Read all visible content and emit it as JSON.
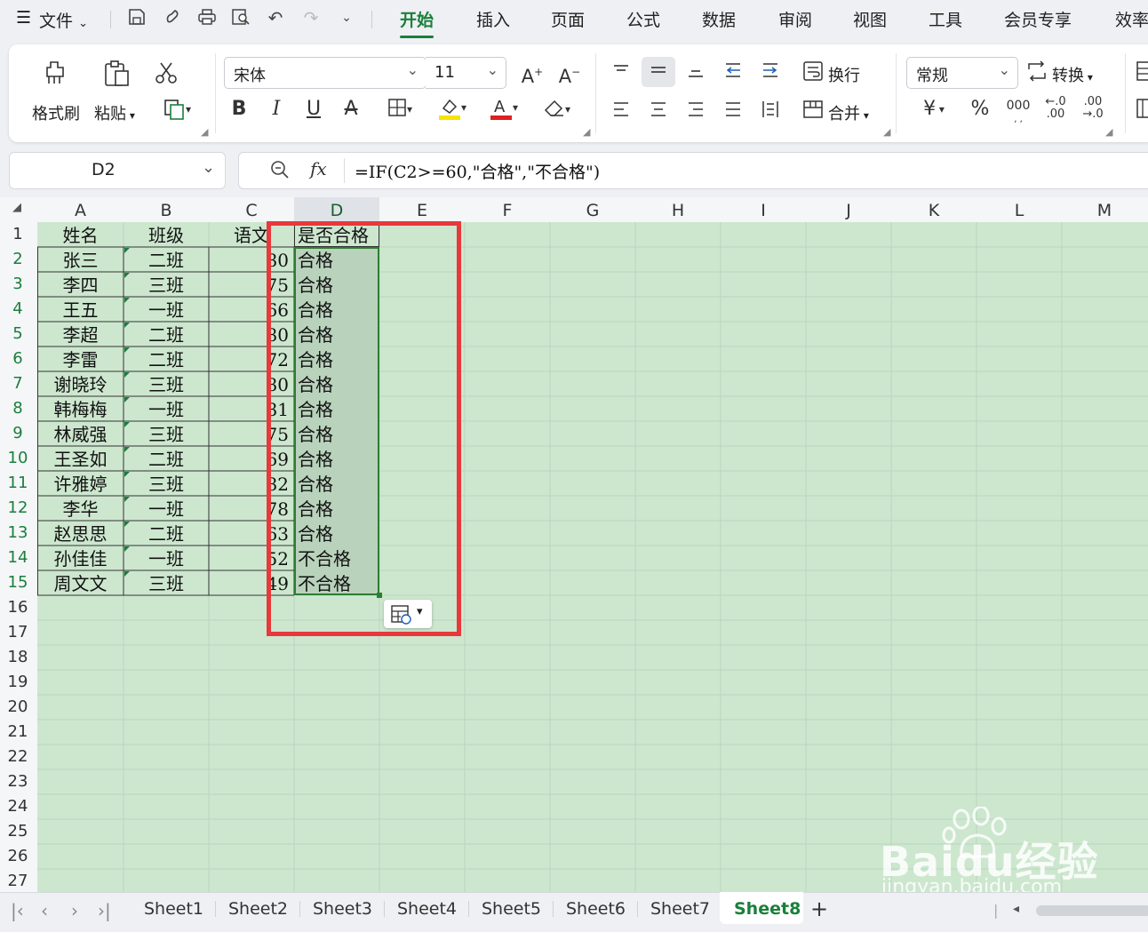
{
  "menu": {
    "file_label": "文件",
    "tabs": [
      "开始",
      "插入",
      "页面",
      "公式",
      "数据",
      "审阅",
      "视图",
      "工具",
      "会员专享",
      "效率"
    ],
    "active_tab_index": 0
  },
  "ribbon": {
    "format_painter": "格式刷",
    "paste": "粘贴",
    "font_name": "宋体",
    "font_size": "11",
    "wrap": "换行",
    "merge": "合并",
    "number_format": "常规",
    "convert": "转换",
    "currency_symbol": "¥",
    "percent_symbol": "%",
    "thousands_symbol": "000"
  },
  "formula_bar": {
    "cell_ref": "D2",
    "fx_label": "fx",
    "formula": "=IF(C2>=60,\"合格\",\"不合格\")"
  },
  "columns": [
    "A",
    "B",
    "C",
    "D",
    "E",
    "F",
    "G",
    "H",
    "I",
    "J",
    "K",
    "L",
    "M"
  ],
  "selected_column": "D",
  "rows": [
    "1",
    "2",
    "3",
    "4",
    "5",
    "6",
    "7",
    "8",
    "9",
    "10",
    "11",
    "12",
    "13",
    "14",
    "15",
    "16",
    "17",
    "18",
    "19",
    "20",
    "21",
    "22",
    "23",
    "24",
    "25",
    "26",
    "27"
  ],
  "header_row": [
    "姓名",
    "班级",
    "语文",
    "是否合格"
  ],
  "data_rows": [
    [
      "张三",
      "二班",
      "80",
      "合格"
    ],
    [
      "李四",
      "三班",
      "75",
      "合格"
    ],
    [
      "王五",
      "一班",
      "66",
      "合格"
    ],
    [
      "李超",
      "二班",
      "80",
      "合格"
    ],
    [
      "李雷",
      "二班",
      "72",
      "合格"
    ],
    [
      "谢晓玲",
      "三班",
      "80",
      "合格"
    ],
    [
      "韩梅梅",
      "一班",
      "81",
      "合格"
    ],
    [
      "林威强",
      "三班",
      "75",
      "合格"
    ],
    [
      "王圣如",
      "二班",
      "69",
      "合格"
    ],
    [
      "许雅婷",
      "三班",
      "82",
      "合格"
    ],
    [
      "李华",
      "一班",
      "78",
      "合格"
    ],
    [
      "赵思思",
      "二班",
      "63",
      "合格"
    ],
    [
      "孙佳佳",
      "一班",
      "52",
      "不合格"
    ],
    [
      "周文文",
      "三班",
      "49",
      "不合格"
    ]
  ],
  "sheets": [
    "Sheet1",
    "Sheet2",
    "Sheet3",
    "Sheet4",
    "Sheet5",
    "Sheet6",
    "Sheet7",
    "Sheet8"
  ],
  "active_sheet_index": 7,
  "watermark": {
    "line1": "Baidu经验",
    "line2": "jingyan.baidu.com"
  },
  "colors": {
    "accent": "#1a7f3c",
    "highlight_box": "#e8383b",
    "sheet_bg": "#cde7cf",
    "selection_fill": "#b9d2bc",
    "selection_border": "#2e7d32"
  }
}
